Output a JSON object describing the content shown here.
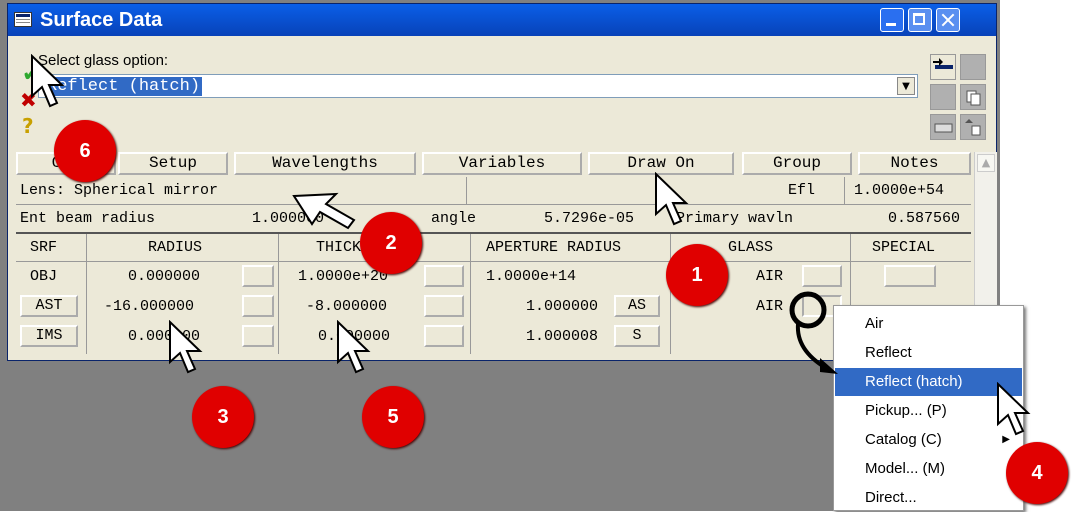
{
  "window": {
    "title": "Surface Data"
  },
  "glass": {
    "label": "Select glass option:",
    "value": "Reflect (hatch)"
  },
  "toolbar_buttons": [
    {
      "label": "Get"
    },
    {
      "label": "Setup"
    },
    {
      "label": "Wavelengths"
    },
    {
      "label": "Variables"
    },
    {
      "label": "Draw On"
    },
    {
      "label": "Group"
    },
    {
      "label": "Notes"
    }
  ],
  "info": {
    "lens_label": "Lens: Spherical mirror",
    "efl_label": "Efl",
    "efl_value": "1.0000e+54",
    "ent_beam_label": "Ent beam radius",
    "ent_beam_value": "1.000000",
    "field_angle_label": "angle",
    "field_angle_value": "5.7296e-05",
    "primary_label": "Primary wavln",
    "primary_value": "0.587560"
  },
  "table": {
    "headers": [
      "SRF",
      "RADIUS",
      "THICKNESS",
      "APERTURE RADIUS",
      "GLASS",
      "SPECIAL"
    ],
    "rows": [
      {
        "srf": "OBJ",
        "radius": "0.000000",
        "thickness": "1.0000e+20",
        "aperture": "1.0000e+14",
        "aperture_btn": "",
        "glass": "AIR"
      },
      {
        "srf": "AST",
        "radius": "-16.000000",
        "thickness": "-8.000000",
        "aperture": "1.000000",
        "aperture_btn": "AS",
        "glass": "AIR"
      },
      {
        "srf": "IMS",
        "radius": "0.000000",
        "thickness": "0.000000",
        "aperture": "1.000008",
        "aperture_btn": "S",
        "glass": ""
      }
    ]
  },
  "context_menu": {
    "items": [
      "Air",
      "Reflect",
      "Reflect (hatch)",
      "Pickup... (P)",
      "Catalog (C)",
      "Model... (M)",
      "Direct..."
    ],
    "highlighted": "Reflect (hatch)"
  },
  "badges": [
    "1",
    "2",
    "3",
    "4",
    "5",
    "6"
  ],
  "colors": {
    "titlebar": "#0a5fe8",
    "highlight": "#316ac5",
    "badge": "#e00000"
  }
}
